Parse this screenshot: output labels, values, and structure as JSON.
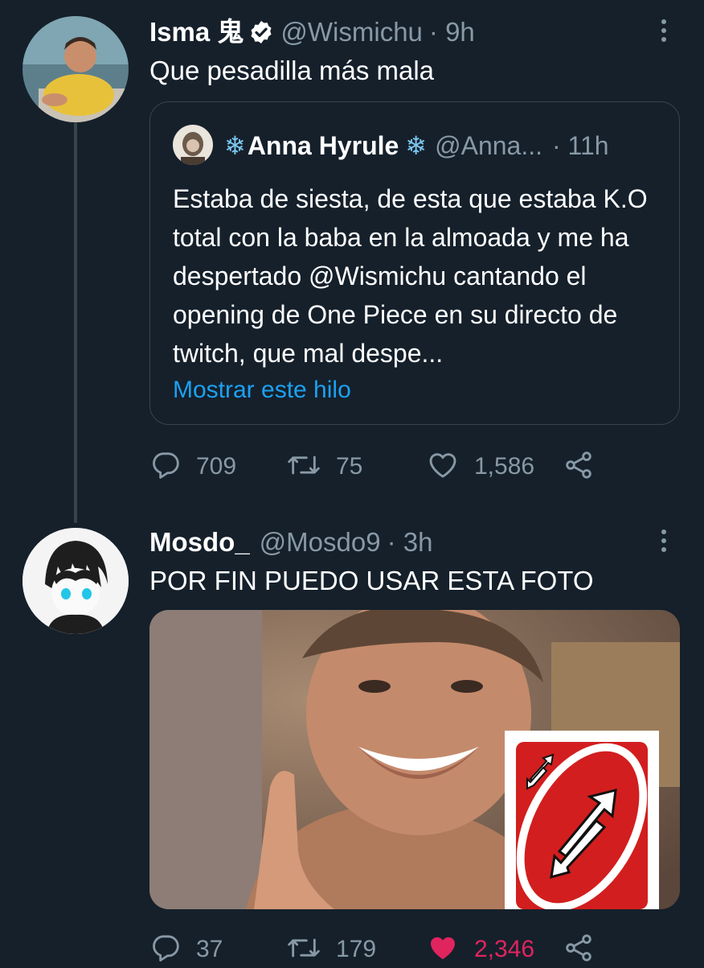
{
  "tweets": [
    {
      "name": "Isma 鬼",
      "handle": "@Wismichu",
      "time": "· 9h",
      "text": "Que pesadilla más mala",
      "quote": {
        "name_prefix": "❄",
        "name": "Anna Hyrule",
        "name_suffix": "❄",
        "handle": "@Anna...",
        "time": "· 11h",
        "text": "Estaba de siesta, de esta que estaba K.O total con la baba en la almoada y me ha despertado @Wismichu cantando el opening de One Piece en su directo de twitch, que mal despe...",
        "show_thread": "Mostrar este hilo"
      },
      "replies": "709",
      "retweets": "75",
      "likes": "1,586",
      "liked": false
    },
    {
      "name": "Mosdo_",
      "handle": "@Mosdo9",
      "time": "· 3h",
      "text": "POR FIN PUEDO USAR ESTA FOTO",
      "replies": "37",
      "retweets": "179",
      "likes": "2,346",
      "liked": true
    }
  ],
  "icons": {
    "reply": "reply-icon",
    "retweet": "retweet-icon",
    "like": "heart-icon",
    "share": "share-icon",
    "more": "more-icon",
    "verified": "verified-badge-icon"
  },
  "colors": {
    "background": "#15202b",
    "muted": "#8899a6",
    "link": "#1da1f2",
    "liked": "#e0245e",
    "border": "#38444d"
  }
}
